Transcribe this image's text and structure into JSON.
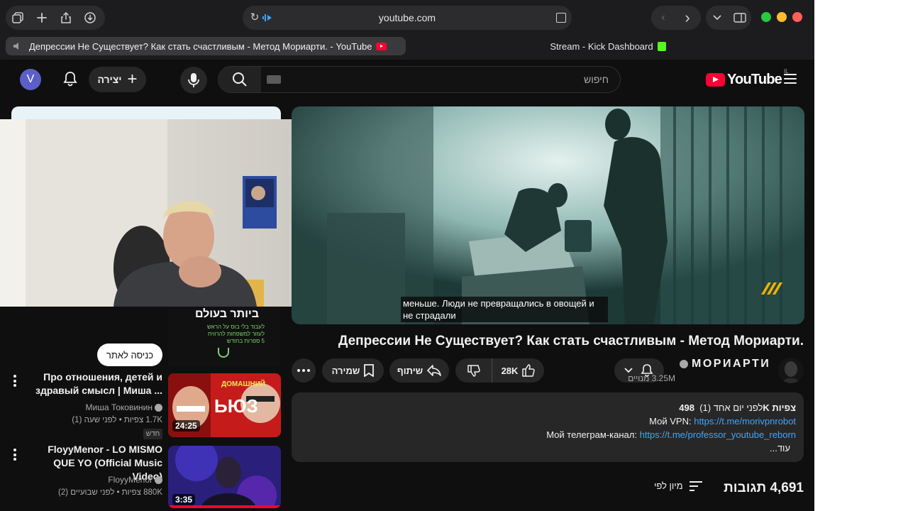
{
  "browser": {
    "url": "youtube.com",
    "tabs": [
      {
        "label": "Депрессии Не Существует? Как стать счастливым - Метод Мориарти. - YouTube",
        "active": true
      },
      {
        "label": "Stream - Kick Dashboard",
        "active": false
      }
    ]
  },
  "header": {
    "avatar_letter": "V",
    "create_label": "יצירה",
    "search_placeholder": "חיפוש",
    "logo_text": "YouTube",
    "logo_country": "IL"
  },
  "ad": {
    "headline": "ביותר בעולם",
    "lines": [
      "לעבוד בלי בוס על הראש",
      "לעזור למשפחות להרוויח",
      "5 ספרות בחודש"
    ],
    "cta_label": "כניסה לאתר"
  },
  "recommendations": [
    {
      "title": "Про отношения, детей и здравый смысл | Миша ...",
      "channel": "Миша Токовинин",
      "meta": "1.7K צפיות • לפני שעה (1)",
      "badge": "חדש",
      "duration": "24:25"
    },
    {
      "title": "FloyyMenor - LO MISMO QUE YO (Official Music Video)",
      "channel": "FloyyMenor",
      "meta": "880K צפיות • לפני שבועיים (2)",
      "duration": "3:35"
    }
  ],
  "video": {
    "subtitle": "меньше. Люди не превращались в овощей и не страдали",
    "title": "Депрессии Не Существует? Как стать счастливым - Метод Мориарти.",
    "channel": "МОРИАРТИ",
    "subscribers": "3.25M מנויים",
    "likes": "28K",
    "share_label": "שיתוף",
    "save_label": "שמירה"
  },
  "description": {
    "views": "498K צפיות",
    "when": "לפני יום אחד (1)",
    "vpn_label": "Мой VPN:",
    "vpn_link": "https://t.me/morivpnrobot",
    "tg_label": "Мой телеграм-канал:",
    "tg_link": "https://t.me/professor_youtube_reborn",
    "more_label": "...עוד"
  },
  "comments": {
    "count_label": "4,691 תגובות",
    "sort_label": "מיון לפי"
  },
  "colors": {
    "background": "#0f0f0f",
    "chip": "#272727",
    "brand_red": "#ff0033",
    "link": "#3ea6ff"
  }
}
